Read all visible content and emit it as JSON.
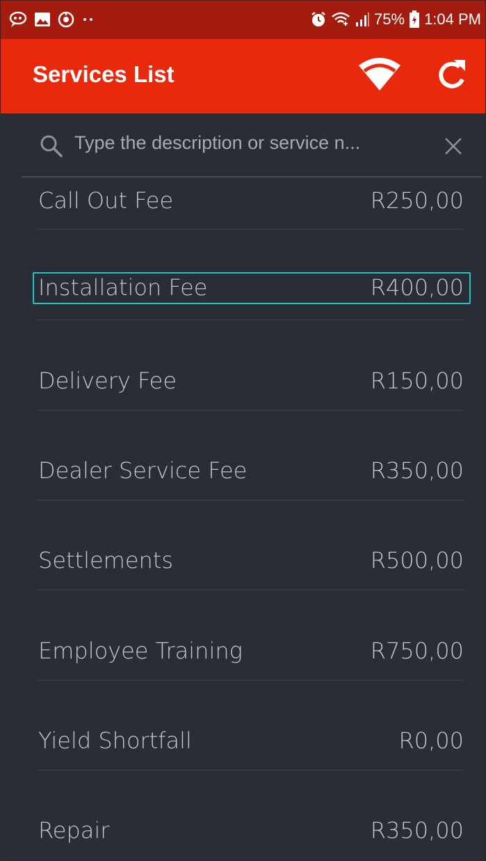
{
  "status_bar": {
    "left_icons": [
      "chat-bubble-icon",
      "gallery-icon",
      "camera-app-icon",
      "more-dots-icon"
    ],
    "right_icons": [
      "alarm-icon",
      "wifi-calling-icon",
      "signal-icon",
      "battery-charging-icon"
    ],
    "battery": "75%",
    "time": "1:04 PM"
  },
  "toolbar": {
    "title": "Services List",
    "wifi_icon": "wifi-icon",
    "refresh_icon": "refresh-icon"
  },
  "search": {
    "placeholder": "Type the description or service n...",
    "value": ""
  },
  "services": [
    {
      "name": "Call Out Fee",
      "price": "R250,00"
    },
    {
      "name": "Installation Fee",
      "price": "R400,00"
    },
    {
      "name": "Delivery Fee",
      "price": "R150,00"
    },
    {
      "name": "Dealer Service Fee",
      "price": "R350,00"
    },
    {
      "name": "Settlements",
      "price": "R500,00"
    },
    {
      "name": "Employee Training",
      "price": "R750,00"
    },
    {
      "name": "Yield Shortfall",
      "price": "R0,00"
    },
    {
      "name": "Repair",
      "price": "R350,00"
    }
  ],
  "colors": {
    "status_bar": "#a51c0e",
    "toolbar": "#e8290b",
    "background": "#2a2d36",
    "selection": "#22c3c9"
  }
}
